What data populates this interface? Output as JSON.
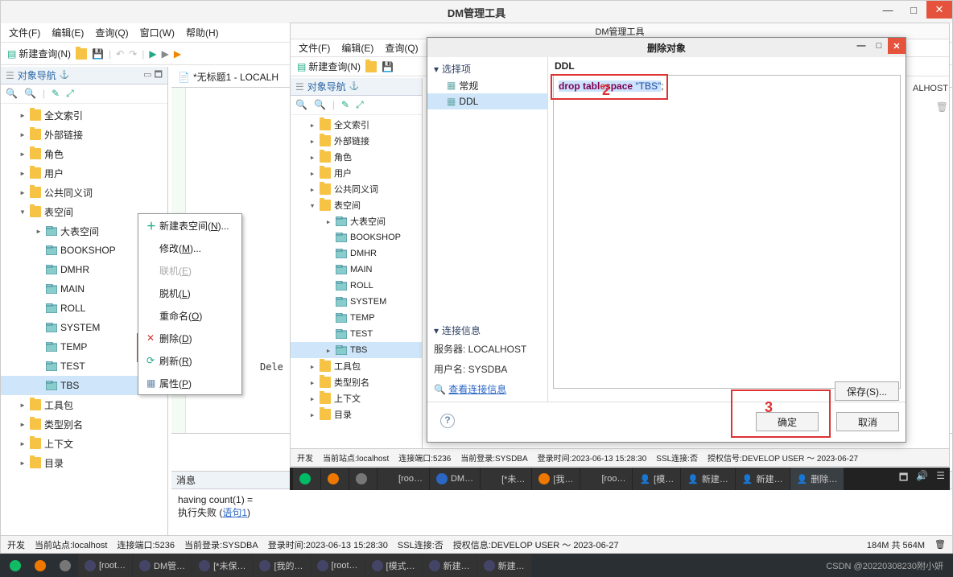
{
  "main_window": {
    "title": "DM管理工具",
    "menubar": [
      "文件(F)",
      "编辑(E)",
      "查询(Q)",
      "窗口(W)",
      "帮助(H)"
    ],
    "new_query": "新建查询(N)",
    "object_nav": "对象导航",
    "tree_items": [
      {
        "lvl": 1,
        "exp": "▸",
        "icon": "folder",
        "label": "全文索引"
      },
      {
        "lvl": 1,
        "exp": "▸",
        "icon": "folder",
        "label": "外部链接"
      },
      {
        "lvl": 1,
        "exp": "▸",
        "icon": "folder",
        "label": "角色"
      },
      {
        "lvl": 1,
        "exp": "▸",
        "icon": "folder",
        "label": "用户"
      },
      {
        "lvl": 1,
        "exp": "▸",
        "icon": "folder",
        "label": "公共同义词"
      },
      {
        "lvl": 1,
        "exp": "▾",
        "icon": "folder",
        "label": "表空间"
      },
      {
        "lvl": 2,
        "exp": "▸",
        "icon": "ts",
        "label": "大表空间"
      },
      {
        "lvl": 2,
        "exp": "",
        "icon": "ts",
        "label": "BOOKSHOP"
      },
      {
        "lvl": 2,
        "exp": "",
        "icon": "ts",
        "label": "DMHR"
      },
      {
        "lvl": 2,
        "exp": "",
        "icon": "ts",
        "label": "MAIN"
      },
      {
        "lvl": 2,
        "exp": "",
        "icon": "ts",
        "label": "ROLL"
      },
      {
        "lvl": 2,
        "exp": "",
        "icon": "ts",
        "label": "SYSTEM"
      },
      {
        "lvl": 2,
        "exp": "",
        "icon": "ts",
        "label": "TEMP"
      },
      {
        "lvl": 2,
        "exp": "",
        "icon": "ts",
        "label": "TEST"
      },
      {
        "lvl": 2,
        "exp": "",
        "icon": "ts",
        "label": "TBS",
        "sel": true
      },
      {
        "lvl": 1,
        "exp": "▸",
        "icon": "folder",
        "label": "工具包"
      },
      {
        "lvl": 1,
        "exp": "▸",
        "icon": "folder",
        "label": "类型别名"
      },
      {
        "lvl": 1,
        "exp": "▸",
        "icon": "folder",
        "label": "上下文"
      },
      {
        "lvl": 1,
        "exp": "▸",
        "icon": "folder",
        "label": "目录"
      }
    ],
    "context_menu": [
      {
        "icon": "plus",
        "label": "新建表空间(N)..."
      },
      {
        "icon": "",
        "label": "修改(M)..."
      },
      {
        "icon": "",
        "label": "联机(E)",
        "disabled": true
      },
      {
        "icon": "",
        "label": "脱机(L)"
      },
      {
        "icon": "",
        "label": "重命名(O)"
      },
      {
        "icon": "x",
        "label": "删除(D)"
      },
      {
        "icon": "refresh",
        "label": "刷新(R)"
      },
      {
        "icon": "doc",
        "label": "属性(P)"
      }
    ],
    "editor_tab": "*无标题1 - LOCALH",
    "editor_delete_hint": "Dele",
    "messages_title": "消息",
    "messages_line1": "having count(1) = ",
    "messages_line2_a": "执行失败 (",
    "messages_link": "语句1",
    "messages_line2_b": ")",
    "statusbar": {
      "dev": "开发",
      "site": "当前站点:localhost",
      "port": "连接端口:5236",
      "login": "当前登录:SYSDBA",
      "time": "登录时间:2023-06-13 15:28:30",
      "ssl": "SSL连接:否",
      "auth": "授权信息:DEVELOP USER ～ 2023-06-27",
      "mem": "184M 共 564M"
    }
  },
  "second_window": {
    "title": "DM管理工具",
    "menubar": [
      "文件(F)",
      "编辑(E)",
      "查询(Q)"
    ],
    "new_query": "新建查询(N)",
    "object_nav": "对象导航",
    "tree_items": [
      {
        "lvl": 1,
        "exp": "▸",
        "icon": "folder",
        "label": "全文索引"
      },
      {
        "lvl": 1,
        "exp": "▸",
        "icon": "folder",
        "label": "外部链接"
      },
      {
        "lvl": 1,
        "exp": "▸",
        "icon": "folder",
        "label": "角色"
      },
      {
        "lvl": 1,
        "exp": "▸",
        "icon": "folder",
        "label": "用户"
      },
      {
        "lvl": 1,
        "exp": "▸",
        "icon": "folder",
        "label": "公共同义词"
      },
      {
        "lvl": 1,
        "exp": "▾",
        "icon": "folder",
        "label": "表空间"
      },
      {
        "lvl": 2,
        "exp": "▸",
        "icon": "ts",
        "label": "大表空间"
      },
      {
        "lvl": 2,
        "exp": "",
        "icon": "ts",
        "label": "BOOKSHOP"
      },
      {
        "lvl": 2,
        "exp": "",
        "icon": "ts",
        "label": "DMHR"
      },
      {
        "lvl": 2,
        "exp": "",
        "icon": "ts",
        "label": "MAIN"
      },
      {
        "lvl": 2,
        "exp": "",
        "icon": "ts",
        "label": "ROLL"
      },
      {
        "lvl": 2,
        "exp": "",
        "icon": "ts",
        "label": "SYSTEM"
      },
      {
        "lvl": 2,
        "exp": "",
        "icon": "ts",
        "label": "TEMP"
      },
      {
        "lvl": 2,
        "exp": "",
        "icon": "ts",
        "label": "TEST"
      },
      {
        "lvl": 2,
        "exp": "▸",
        "icon": "ts",
        "label": "TBS",
        "sel": true
      },
      {
        "lvl": 1,
        "exp": "▸",
        "icon": "folder",
        "label": "工具包"
      },
      {
        "lvl": 1,
        "exp": "▸",
        "icon": "folder",
        "label": "类型别名"
      },
      {
        "lvl": 1,
        "exp": "▸",
        "icon": "folder",
        "label": "上下文"
      },
      {
        "lvl": 1,
        "exp": "▸",
        "icon": "folder",
        "label": "目录"
      }
    ],
    "statusbar": {
      "dev": "开发",
      "site": "当前站点:localhost",
      "port": "连接端口:5236",
      "login": "当前登录:SYSDBA",
      "time": "登录时间:2023-06-13 15:28:30",
      "ssl": "SSL连接:否",
      "auth": "授权信号:DEVELOP USER ～ 2023-06-27"
    }
  },
  "dialog": {
    "title": "删除对象",
    "side_group1": "选择项",
    "side_items": [
      "常规",
      "DDL"
    ],
    "ddl_label": "DDL",
    "ddl_code_p1": "drop tabl",
    "ddl_code_p2": "space",
    "ddl_code_str": "\"TBS\"",
    "ddl_code_end": ";",
    "side_group2": "连接信息",
    "server": "服务器: LOCALHOST",
    "user": "用户名: SYSDBA",
    "view_link": "查看连接信息",
    "help_icon": "?",
    "save_btn": "保存(S)...",
    "ok_btn": "确定",
    "cancel_btn": "取消"
  },
  "right_fragment": "ALHOST",
  "bottom_taskbar1": {
    "items": [
      {
        "label": "",
        "color": "#0b6"
      },
      {
        "label": "",
        "color": "#e70"
      },
      {
        "label": "",
        "color": "#777"
      },
      {
        "label": "[roo…",
        "color": "#333"
      },
      {
        "label": "DM…",
        "color": "#2a67c5"
      },
      {
        "label": "[*未…",
        "color": "#333"
      },
      {
        "label": "[我…",
        "color": "#e70"
      },
      {
        "label": "[roo…",
        "color": "#333"
      },
      {
        "label": "[模…",
        "color": "#2a67c5"
      },
      {
        "label": "新建…",
        "color": "#2a67c5"
      },
      {
        "label": "新建…",
        "color": "#2a67c5"
      },
      {
        "label": "删除…",
        "color": "#2a67c5",
        "active": true
      }
    ]
  },
  "os_taskbar": {
    "items": [
      "[root…",
      "DM管…",
      "[*未保…",
      "[我的…",
      "[root…",
      "[模式…",
      "新建…",
      "新建…"
    ],
    "watermark": "CSDN @20220308230附小妍"
  }
}
